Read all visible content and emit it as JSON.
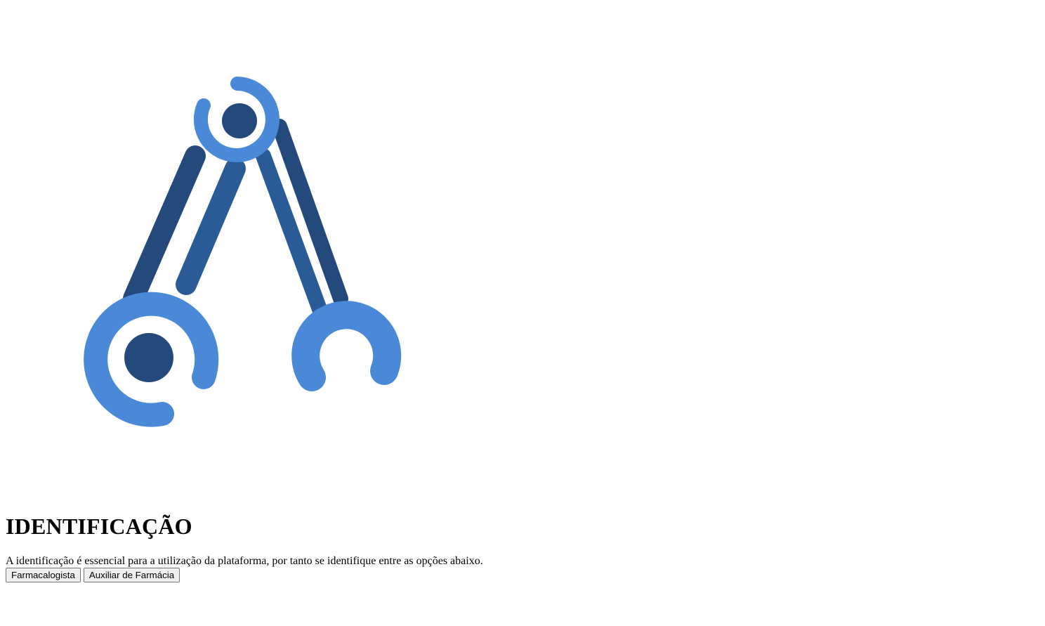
{
  "logo": {
    "icon": "crossed-wrenches-icon",
    "colors": {
      "dark": "#234a7a",
      "mid": "#2a5b97",
      "light": "#4a88d8"
    }
  },
  "heading": "IDENTIFICAÇÃO",
  "description": "A identificação é essencial para a utilização da plataforma, por tanto se identifique entre as opções abaixo.",
  "buttons": {
    "pharmacist": "Farmacalogista",
    "assistant": "Auxiliar de Farmácia"
  }
}
